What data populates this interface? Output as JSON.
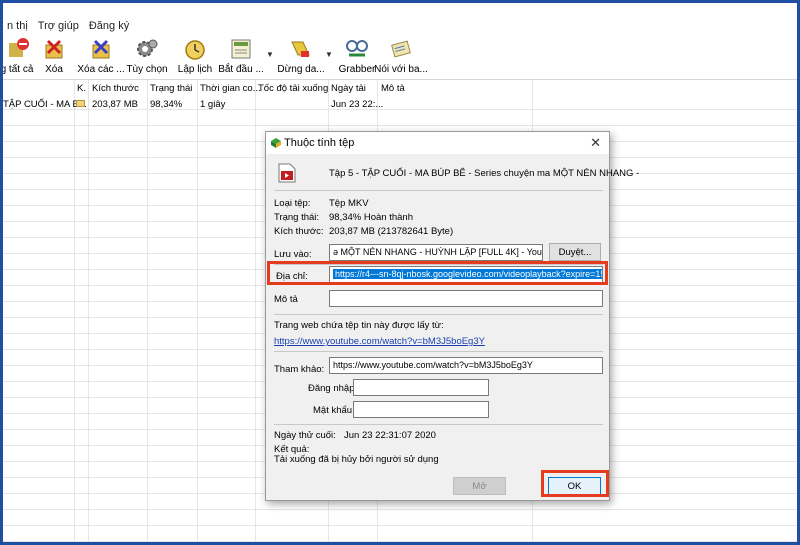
{
  "menu": {
    "items": [
      "n thị",
      "Trợ giúp",
      "Đăng ký"
    ]
  },
  "toolbar": {
    "buttons": [
      {
        "label": "g tất cả",
        "icon": "stop-all-icon"
      },
      {
        "label": "Xóa",
        "icon": "delete-icon"
      },
      {
        "label": "Xóa các ...",
        "icon": "delete-completed-icon"
      },
      {
        "label": "Tùy chọn",
        "icon": "gear-icon"
      },
      {
        "label": "Lập lịch",
        "icon": "clock-icon"
      },
      {
        "label": "Bắt đầu ...",
        "icon": "start-queue-icon"
      },
      {
        "label": "Dừng da...",
        "icon": "stop-queue-icon"
      },
      {
        "label": "Grabber",
        "icon": "grabber-icon"
      },
      {
        "label": "Nói với ba...",
        "icon": "tell-friend-icon"
      }
    ]
  },
  "list": {
    "headers": [
      "K.",
      "Kích thước",
      "Trạng thái",
      "Thời gian co...",
      "Tốc độ tải xuống",
      "Ngày tải",
      "Mô tả"
    ],
    "row": {
      "name": "TẬP CUỐI - MA B...",
      "size": "203,87  MB",
      "status": "98,34%",
      "time_left": "1 giây",
      "date": "Jun 23 22:..."
    }
  },
  "dialog": {
    "title": "Thuộc tính tệp",
    "close": "✕",
    "file_name": "Tập 5 - TẬP CUỐI - MA BÚP BÊ - Series chuyện ma MỘT NÉN NHANG -",
    "type_label": "Loại tệp:",
    "type_value": "Tệp MKV",
    "status_label": "Trạng thái:",
    "status_value": "98,34% Hoàn thành",
    "size_label": "Kích thước:",
    "size_value": "203,87  MB (213782641 Byte)",
    "save_label": "Lưu vào:",
    "save_value": "ə MỘT NÉN NHANG - HUỲNH LẬP [FULL 4K] - YouTube.mkv",
    "browse_label": "Duyệt...",
    "address_label": "Địa chỉ:",
    "address_value": "https://r4---sn-8qj-nbosk.googlevideo.com/videoplayback?expire=15929483",
    "desc_label": "Mô tả",
    "desc_value": "",
    "source_label": "Trang web chứa tệp tin này được lấy từ:",
    "source_link": "https://www.youtube.com/watch?v=bM3J5boEg3Y",
    "ref_label": "Tham khảo:",
    "ref_value": "https://www.youtube.com/watch?v=bM3J5boEg3Y",
    "login_label": "Đăng nhập",
    "login_value": "",
    "password_label": "Mật khẩu",
    "password_value": "",
    "last_try_label": "Ngày thử cuối:",
    "last_try_value": "Jun 23 22:31:07 2020",
    "result_label": "Kết quả:",
    "result_value": "Tải xuống đã bị hủy bởi người sử dụng",
    "open_label": "Mở",
    "ok_label": "OK"
  },
  "colors": {
    "highlight": "#e53b1f",
    "selection": "#0078d7",
    "frame": "#1f4fa0"
  }
}
